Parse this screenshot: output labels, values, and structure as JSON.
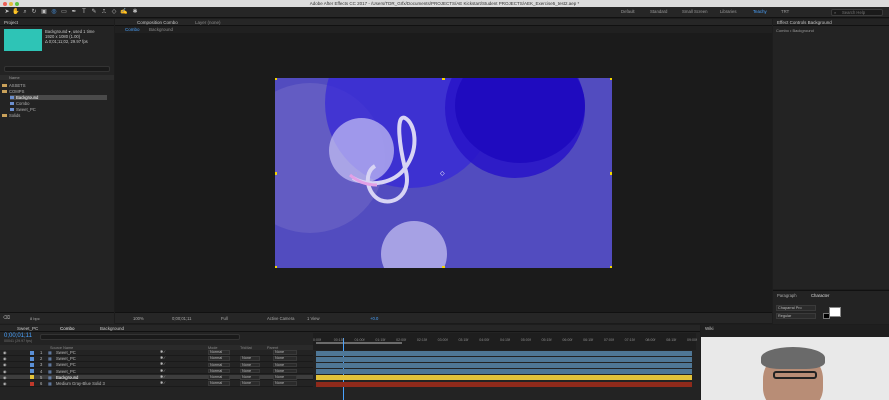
{
  "window": {
    "title": "Adobe After Effects CC 2017 - /Users/TDR_Grfx/Documents/PROJECTS/AE Kickstart/Student PROJECTS/AEK_Exercise5_test2.aep *"
  },
  "workspaces": [
    "Default",
    "Standard",
    "Small Screen",
    "Libraries",
    "Teachy",
    "TRT"
  ],
  "active_workspace": "Teachy",
  "search_help": {
    "placeholder": "Search Help"
  },
  "project": {
    "title": "Project",
    "preview_name": "Background ▾, used 1 time",
    "preview_meta1": "1920 x 1080 (1.00)",
    "preview_meta2": "Δ 0;01;11;02, 29.97 fps",
    "name_header": "Name",
    "tree": [
      "ASSETS",
      "COMPS",
      "Background",
      "Combo",
      "Sweet_PC",
      "Solids"
    ],
    "bpc": "8 bpc"
  },
  "viewer": {
    "comp_tab": "Composition Combo",
    "layer_tab": "Layer (none)",
    "crumbs": [
      "Combo",
      "Background"
    ],
    "zoom": "100%",
    "timecode": "0;00;01;11",
    "resolution": "Full",
    "camera": "Active Camera",
    "view": "1 View",
    "exposure": "+0.0"
  },
  "effect_controls": {
    "title": "Effect Controls Background",
    "sub": "Combo • Background"
  },
  "character": {
    "tab_paragraph": "Paragraph",
    "tab_character": "Character",
    "font": "Chaparral Pro",
    "style": "Regular"
  },
  "timeline": {
    "tabs": [
      "Sweet_PC",
      "Combo",
      "Background"
    ],
    "timecode": "0;00;01;11",
    "timecode_sub": "00041 (29.97 fps)",
    "headers": [
      "Source Name",
      "Mode",
      "TrkMat",
      "Parent"
    ],
    "ticks": [
      "0:00f",
      "00:15f",
      "01:00f",
      "01:15f",
      "02:00f",
      "02:15f",
      "03:00f",
      "03:15f",
      "04:00f",
      "04:15f",
      "05:00f",
      "05:15f",
      "06:00f",
      "06:15f",
      "07:00f",
      "07:15f",
      "08:00f",
      "08:15f",
      "09:00f"
    ],
    "layers": [
      {
        "num": "1",
        "name": "Sweet_PC",
        "mode": "Normal",
        "trkmat": "",
        "parent": "None",
        "label": "#5a8fd6"
      },
      {
        "num": "2",
        "name": "Sweet_PC",
        "mode": "Normal",
        "trkmat": "None",
        "parent": "None",
        "label": "#5a8fd6"
      },
      {
        "num": "3",
        "name": "Sweet_PC",
        "mode": "Normal",
        "trkmat": "None",
        "parent": "None",
        "label": "#5a8fd6"
      },
      {
        "num": "4",
        "name": "Sweet_PC",
        "mode": "Normal",
        "trkmat": "None",
        "parent": "None",
        "label": "#5a8fd6"
      },
      {
        "num": "5",
        "name": "Background",
        "mode": "Normal",
        "trkmat": "None",
        "parent": "None",
        "label": "#e3c33a"
      },
      {
        "num": "6",
        "name": "Medium Gray-Blue Solid 3",
        "mode": "Normal",
        "trkmat": "None",
        "parent": "None",
        "label": "#c0392b"
      }
    ]
  },
  "right_lower": {
    "tab": "Wiki"
  },
  "colors": {
    "accent": "#4aa3ff",
    "canvas": "#524cbf",
    "bar_blue": "#4f7796",
    "bar_yellow": "#e3c33a",
    "bar_red": "#8f2a1b",
    "swatch": "#2ec4b6"
  }
}
